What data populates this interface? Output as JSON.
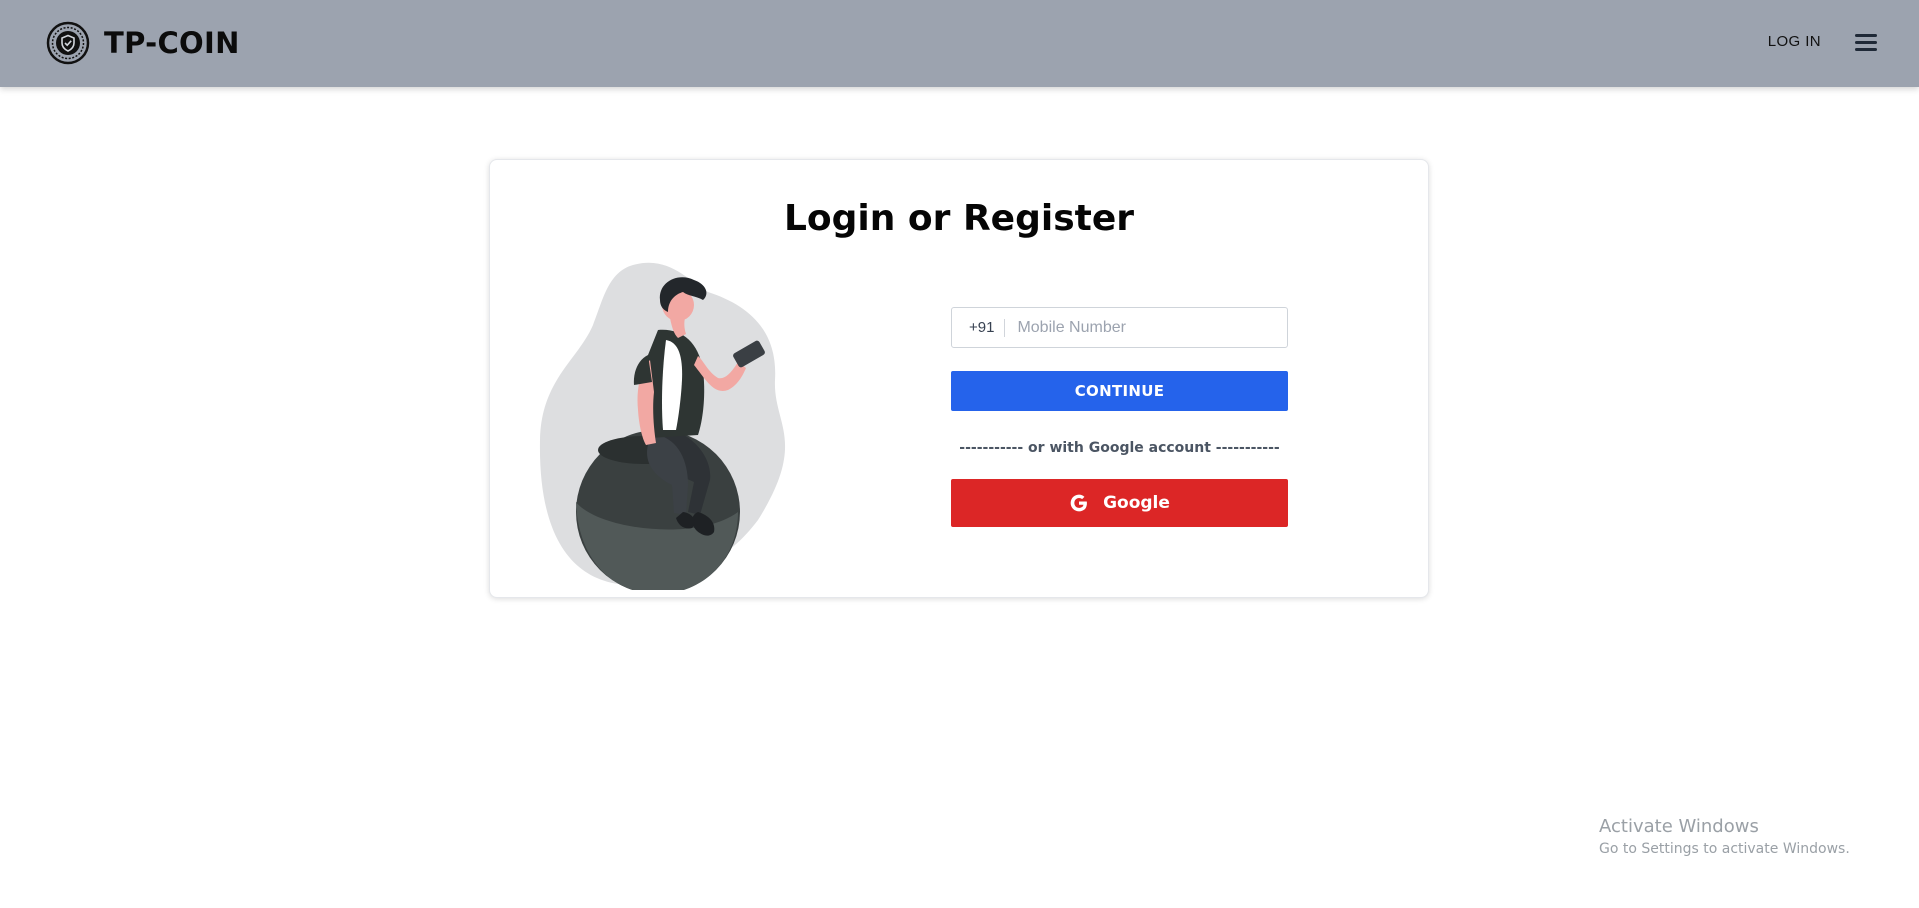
{
  "header": {
    "brand_name": "TP-COIN",
    "logo_icon": "shield-coin-logo-icon",
    "login_label": "LOG IN",
    "menu_icon": "hamburger-menu-icon"
  },
  "card": {
    "title": "Login or Register",
    "illustration": "person-sitting-on-ball-with-phone-illustration"
  },
  "form": {
    "country_code": "+91",
    "mobile_placeholder": "Mobile Number",
    "mobile_value": "",
    "continue_label": "CONTINUE",
    "divider_text": "----------- or with Google account -----------",
    "google_label": "Google",
    "google_icon": "google-g-icon"
  },
  "watermark": {
    "title": "Activate Windows",
    "subtitle": "Go to Settings to activate Windows."
  },
  "colors": {
    "header_bg": "#9ca3af",
    "continue_bg": "#2563eb",
    "google_bg": "#dc2626",
    "title_text": "#050505"
  }
}
